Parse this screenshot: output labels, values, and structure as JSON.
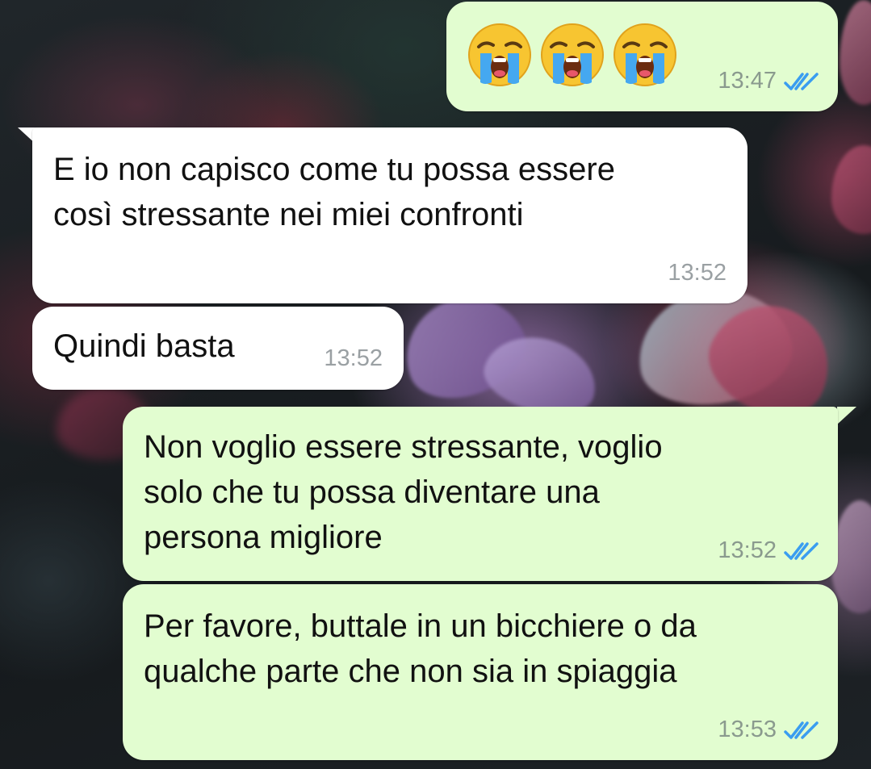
{
  "chat": {
    "messages": [
      {
        "direction": "outgoing",
        "emojis": [
          {
            "icon": "loudly-crying-face-emoji"
          },
          {
            "icon": "loudly-crying-face-emoji"
          },
          {
            "icon": "loudly-crying-face-emoji"
          }
        ],
        "time": "13:47",
        "status_icon": "double-check-read-icon"
      },
      {
        "direction": "incoming",
        "text": "E io non capisco come tu possa essere\ncosì stressante nei miei confronti",
        "time": "13:52"
      },
      {
        "direction": "incoming",
        "text": "Quindi basta",
        "time": "13:52"
      },
      {
        "direction": "outgoing",
        "text": "Non voglio essere stressante, voglio\nsolo che tu possa diventare una\npersona migliore",
        "time": "13:52",
        "status_icon": "double-check-read-icon"
      },
      {
        "direction": "outgoing",
        "text": "Per favore, buttale in un bicchiere o da\nqualche parte che non sia in spiaggia",
        "time": "13:53",
        "status_icon": "double-check-read-icon"
      }
    ]
  },
  "colors": {
    "outgoing_bubble": "#e2fdd0",
    "incoming_bubble": "#ffffff",
    "read_ticks": "#3a9df0"
  }
}
